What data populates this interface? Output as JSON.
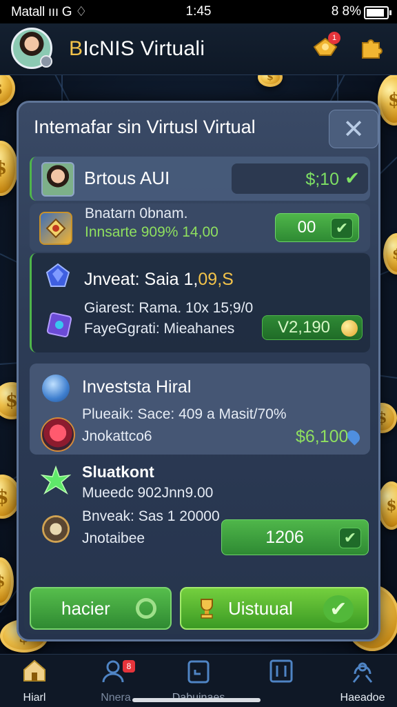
{
  "status_bar": {
    "carrier": "Matall ııı G ♢",
    "time": "1:45",
    "battery": "8 8%",
    "battery_level": 0.88
  },
  "header": {
    "title_glyph": "B",
    "title": "IcNIS Virtuali",
    "notification_count": "1",
    "icons": [
      "avatar",
      "trophy-icon",
      "gold-puzzle-icon"
    ]
  },
  "modal": {
    "title": "Intemafar sin Virtusl Virtual",
    "close_label": "✕",
    "player": {
      "name": "Brtous AUI",
      "balance": "$;10"
    },
    "first_row": {
      "line1": "Bnatarn 0bnam.",
      "line2": "Innsarte 909% 14,00",
      "button_value": "00"
    },
    "invest": {
      "title_white": "Jnveat: Saia 1,",
      "title_gold": "09,S",
      "line1": "Giarest: Rama. 10x 15;9/0",
      "line2": "FayeGgrati: Mieahanes",
      "button_value": "V2,190"
    },
    "invest_hiral": {
      "title": "Investsta Hiral",
      "line1": "Plueaik: Sace: 409 a Masit/70%",
      "line2": "Jnokattco6",
      "value": "$6,100"
    },
    "sluatkont": {
      "title": "Sluatkont",
      "line1": "Mueedc 902Jnn9.00",
      "line2": "Bnveak: Sas 1 20000",
      "line3": "Jnotaibee",
      "button_value": "1206"
    },
    "buttons": {
      "left": "hacier",
      "right": "Uistuual"
    }
  },
  "nav": {
    "items": [
      {
        "label": "Hiarl",
        "icon": "home-icon"
      },
      {
        "label": "Nnera",
        "icon": "people-icon",
        "badge": "8"
      },
      {
        "label": "Dabuinaes",
        "icon": "clipboard-icon"
      },
      {
        "label": "",
        "icon": "box-icon"
      },
      {
        "label": "Haeadoe",
        "icon": "headset-icon"
      }
    ]
  },
  "colors": {
    "accent_green": "#4fb64a",
    "gold": "#f3c34a",
    "panel": "#2d3c56"
  }
}
